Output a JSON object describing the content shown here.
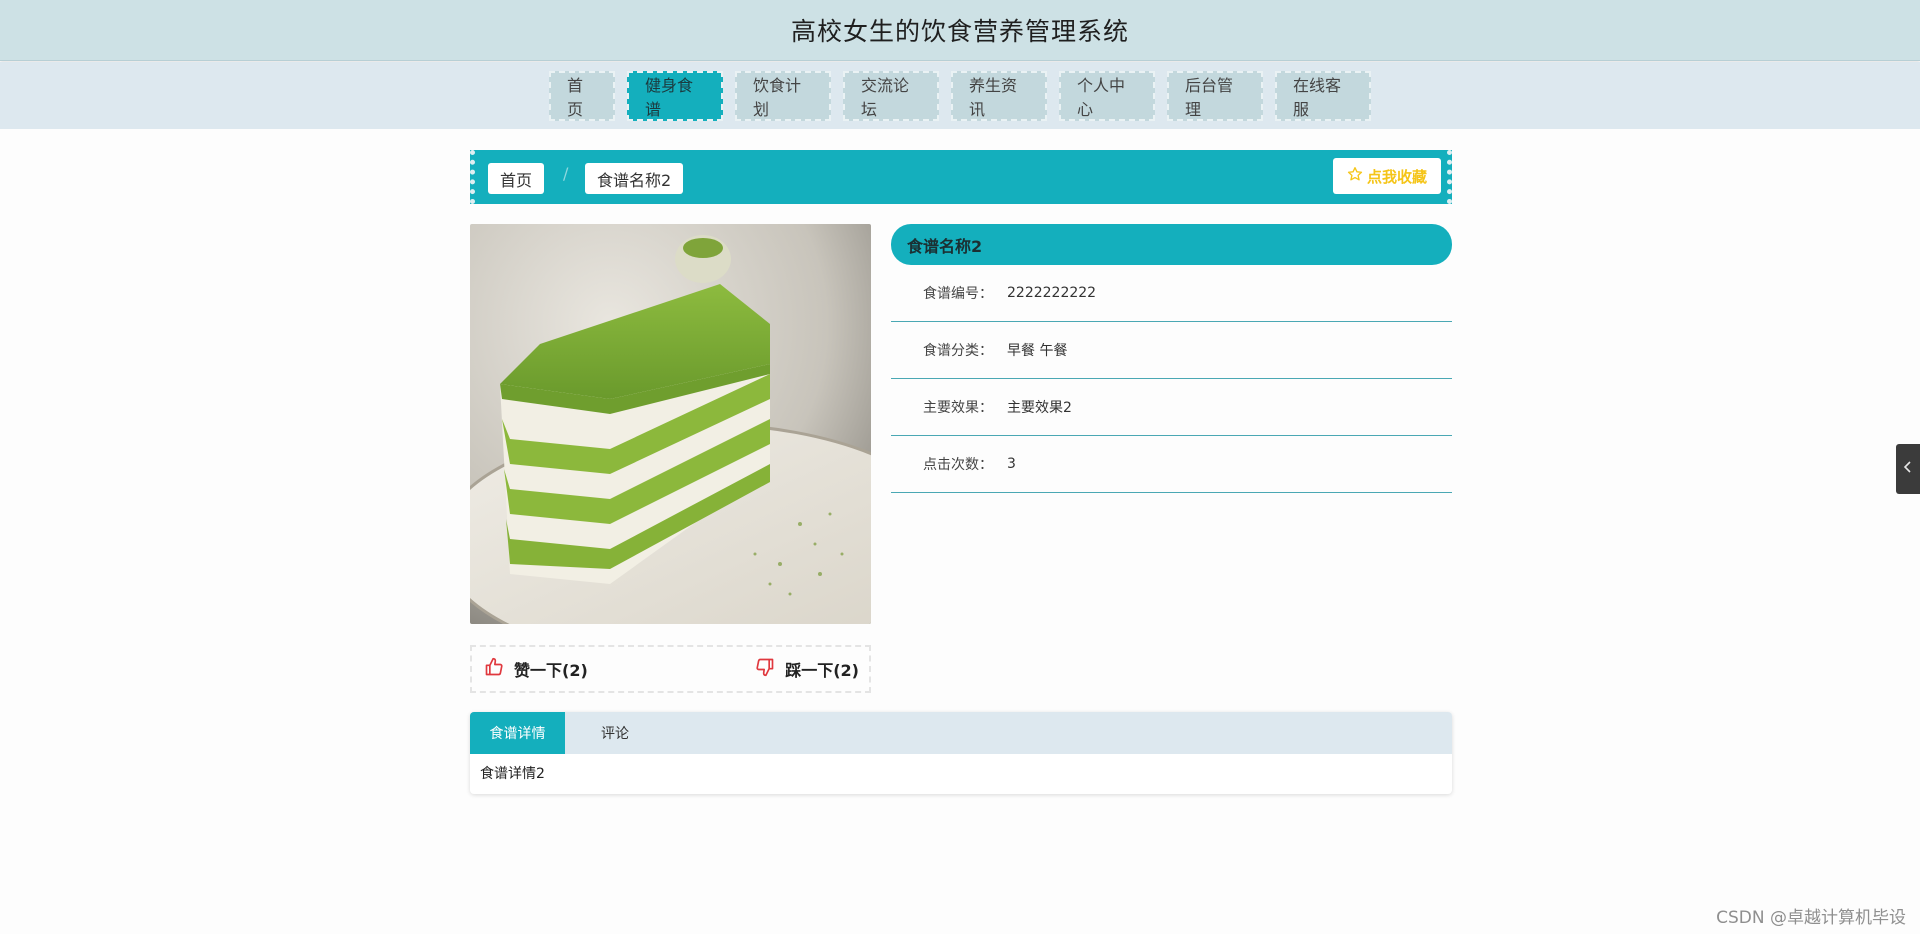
{
  "header": {
    "title": "高校女生的饮食营养管理系统"
  },
  "nav": {
    "items": [
      {
        "label": "首页"
      },
      {
        "label": "健身食谱"
      },
      {
        "label": "饮食计划"
      },
      {
        "label": "交流论坛"
      },
      {
        "label": "养生资讯"
      },
      {
        "label": "个人中心"
      },
      {
        "label": "后台管理"
      },
      {
        "label": "在线客服"
      }
    ],
    "active_index": 1,
    "active_color": "#14afbd"
  },
  "breadcrumb": {
    "home": "首页",
    "separator": "/",
    "current": "食谱名称2",
    "favorite_label": "点我收藏",
    "favorite_icon": "star-icon"
  },
  "image": {
    "alt": "抹茶千层蛋糕"
  },
  "vote": {
    "like_label": "赞一下(2)",
    "dislike_label": "踩一下(2)",
    "like_icon": "thumbs-up-icon",
    "dislike_icon": "thumbs-down-icon"
  },
  "detail": {
    "title": "食谱名称2",
    "rows": [
      {
        "label": "食谱编号：",
        "value": "2222222222"
      },
      {
        "label": "食谱分类：",
        "value": "早餐 午餐"
      },
      {
        "label": "主要效果：",
        "value": "主要效果2"
      },
      {
        "label": "点击次数：",
        "value": "3"
      }
    ]
  },
  "tabs": {
    "items": [
      {
        "label": "食谱详情"
      },
      {
        "label": "评论"
      }
    ],
    "content": "食谱详情2"
  },
  "watermark": "CSDN @卓越计算机毕设",
  "colors": {
    "accent": "#14afbd",
    "header_bg": "#cde1e5",
    "nav_bg": "#dde8ef"
  }
}
